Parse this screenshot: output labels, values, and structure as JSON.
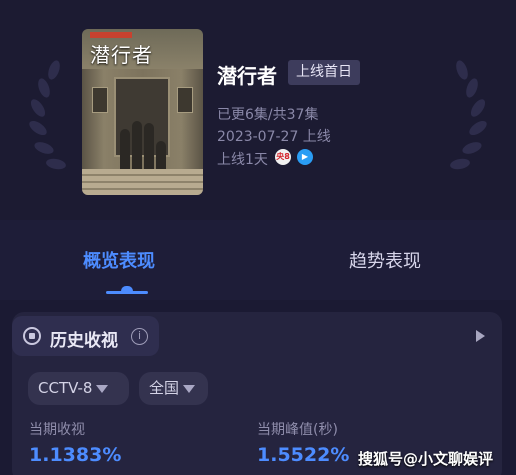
{
  "show": {
    "title": "潜行者",
    "badge": "上线首日",
    "episodes": "已更6集/共37集",
    "release": "2023-07-27 上线",
    "online_days": "上线1天",
    "poster_title": "潜行者"
  },
  "platforms": [
    {
      "name": "cctv8-logo",
      "label": "央8"
    },
    {
      "name": "iqiyi-logo",
      "label": "▶"
    }
  ],
  "tabs": [
    {
      "label": "概览表现",
      "active": true
    },
    {
      "label": "趋势表现",
      "active": false
    }
  ],
  "section": {
    "title": "历史收视",
    "info_icon": "info-icon"
  },
  "filters": {
    "channel": "CCTV-8",
    "region": "全国"
  },
  "stats": {
    "period_rating_label": "当期收视",
    "period_rating_value": "1.1383%",
    "peak_label": "当期峰值(秒)",
    "peak_value": "1.5522%"
  },
  "watermark": "搜狐号@小文聊娱评",
  "colors": {
    "accent": "#4d8cff",
    "background": "#1b1a33"
  }
}
